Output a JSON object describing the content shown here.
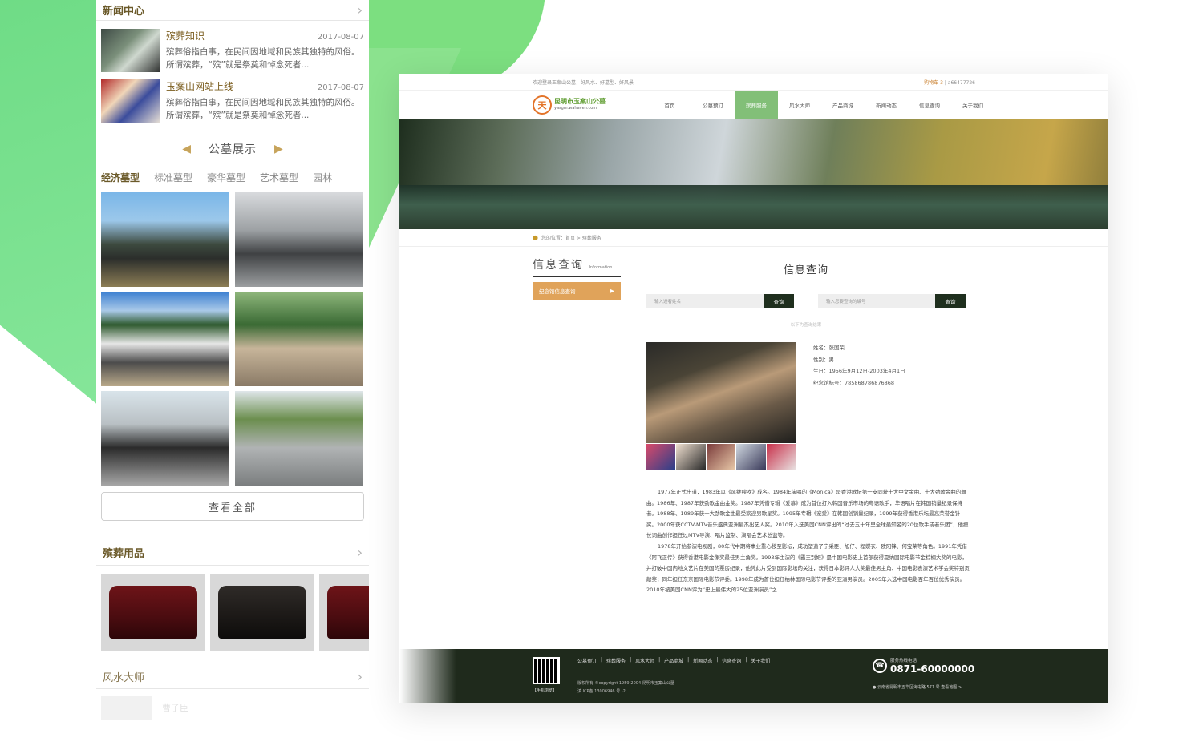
{
  "mobile": {
    "news_header": "新闻中心",
    "news": [
      {
        "title": "殡葬知识",
        "date": "2017-08-07",
        "desc": "殡葬俗指白事，在民间因地域和民族其独特的风俗。所谓殡葬，“殡”就是祭奠和悼念死者..."
      },
      {
        "title": "玉案山网站上线",
        "date": "2017-08-07",
        "desc": "殡葬俗指白事，在民间因地域和民族其独特的风俗。所谓殡葬，“殡”就是祭奠和悼念死者..."
      }
    ],
    "cemetery_title": "公墓展示",
    "tabs": [
      "经济墓型",
      "标准墓型",
      "豪华墓型",
      "艺术墓型",
      "园林"
    ],
    "view_all": "查看全部",
    "products_header": "殡葬用品",
    "fengshui_header": "风水大师",
    "fade_text": "曹子臣"
  },
  "desktop": {
    "topbar_left": "欢迎登录玉案山公墓，好风水、好墓型、好风景",
    "topbar_cart": "购物车 3",
    "topbar_phone": "a66477726",
    "logo_text": "昆明市玉案山公墓",
    "logo_mark": "天",
    "logo_sub": "yasgm.wahaven.com",
    "nav": [
      "首页",
      "公墓预订",
      "殡葬服务",
      "风水大师",
      "产品商城",
      "新闻动态",
      "信息查询",
      "关于我们"
    ],
    "breadcrumb": "您的位置：首页 > 殡葬服务",
    "side_title": "信息查询",
    "side_title_en": "Information",
    "side_button": "纪念馆信息查询",
    "content_title": "信息查询",
    "search1_placeholder": "输入逝者姓名",
    "search1_button": "查询",
    "search2_placeholder": "输入您要查询的编号",
    "search2_button": "查询",
    "result_label": "以下为查询结果",
    "info": [
      "姓名：张国荣",
      "性别：男",
      "生日：1956年9月12日-2003年4月1日",
      "纪念馆标号：785868786876868"
    ],
    "bio": [
      "1977年正式出道，1983年以《风继续吹》成名。1984年演唱的《Monica》是香港歌坛第一支同获十大中文金曲、十大劲歌金曲的舞曲。1986年、1987年获劲歌金曲金奖。1987年凭借专辑《爱慕》成为首位打入韩国音乐市场的粤语歌手，华语唱片在韩国销量纪录保持者。1988年、1989年获十大劲歌金曲最受欢迎男歌星奖。1995年专辑《宠爱》在韩国创销量纪录，1999年获得香港乐坛最高荣誉金针奖。2000年获CCTV-MTV音乐盛典亚洲最杰出艺人奖。2010年入选美国CNN评出的“过去五十年里全球最知名的20位歌手或者乐团”，他擅长词曲创作担任过MTV导演、唱片监制、演唱会艺术总监等。",
      "1978年开始参演电视剧，80年代中期将事业重心移至影坛，成功塑造了宁采臣、旭仔、程蝶衣、欧阳锋、何宝荣等角色。1991年凭借《阿飞正传》获得香港电影金像奖最佳男主角奖。1993年主演的《霸王别姬》是中国电影史上首部获得戛纳国际电影节金棕榈大奖的电影，并打破中国内地文艺片在美国的票房纪录，他凭此片受到国际影坛的关注，获得日本影评人大奖最佳男主角、中国电影表演艺术学会奖特别贡献奖；同年担任东京国际电影节评委。1998年成为首位担任柏林国际电影节评委的亚洲男演员。2005年入选中国电影百年百位优秀演员。2010年被美国CNN评为“史上最伟大的25位亚洲演员”之"
    ],
    "footer_links": [
      "公墓预订",
      "|",
      "殡葬服务",
      "|",
      "风水大师",
      "|",
      "产品商城",
      "|",
      "新闻动态",
      "|",
      "信息查询",
      "|",
      "关于我们"
    ],
    "qr_label": "【手机浏览】",
    "copyright_1": "版权所有 ©copyright 1959-2004 昆明市玉案山公墓",
    "copyright_2": "滇 ICP备 13006946 号 -2",
    "hotline_label": "服务热线电话",
    "hotline": "0871-60000000",
    "address": "云南省昆明市五华区海屯路 571 号    查看地图 >"
  }
}
